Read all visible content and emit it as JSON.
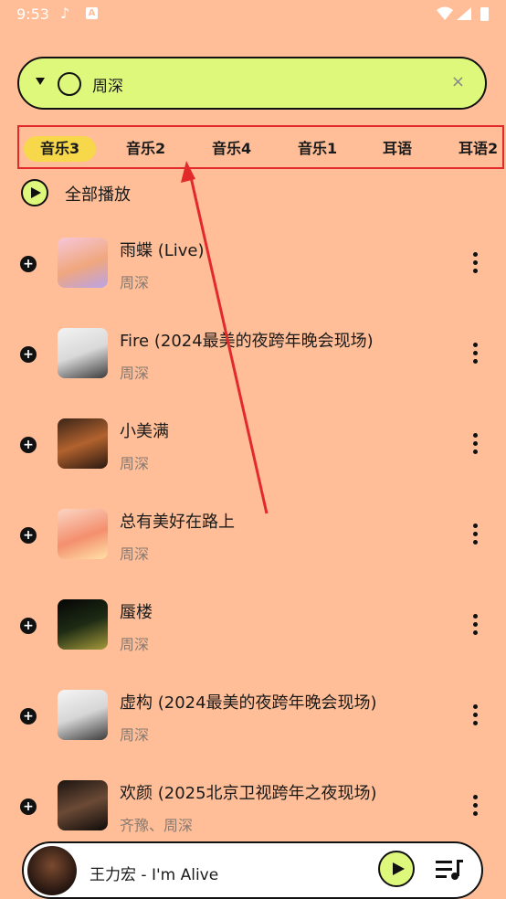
{
  "status": {
    "time": "9:53"
  },
  "search": {
    "query": "周深",
    "clear": "×"
  },
  "tabs": [
    "音乐3",
    "音乐2",
    "音乐4",
    "音乐1",
    "耳语",
    "耳语2"
  ],
  "play_all": {
    "label": "全部播放"
  },
  "songs": [
    {
      "title": "雨蝶 (Live)",
      "artist": "周深"
    },
    {
      "title": "Fire (2024最美的夜跨年晚会现场)",
      "artist": "周深"
    },
    {
      "title": "小美满",
      "artist": "周深"
    },
    {
      "title": "总有美好在路上",
      "artist": "周深"
    },
    {
      "title": "蜃楼",
      "artist": "周深"
    },
    {
      "title": "虚构 (2024最美的夜跨年晚会现场)",
      "artist": "周深"
    },
    {
      "title": "欢颜 (2025北京卫视跨年之夜现场)",
      "artist": "齐豫、周深"
    }
  ],
  "player": {
    "title": "王力宏 - I'm Alive"
  },
  "icons": {
    "status": [
      "music-note-icon",
      "app-a-icon",
      "wifi-icon",
      "signal-icon",
      "battery-icon"
    ],
    "search": [
      "dropdown-arrow-icon",
      "circle-icon",
      "clear-icon"
    ],
    "song": [
      "add-icon",
      "more-vert-icon"
    ],
    "player": [
      "play-icon",
      "playlist-icon"
    ]
  },
  "colors": {
    "background": "#FFBE97",
    "accent": "#DDF87A",
    "tab_active": "#F6D84A",
    "annotation": "#E32A2A"
  }
}
